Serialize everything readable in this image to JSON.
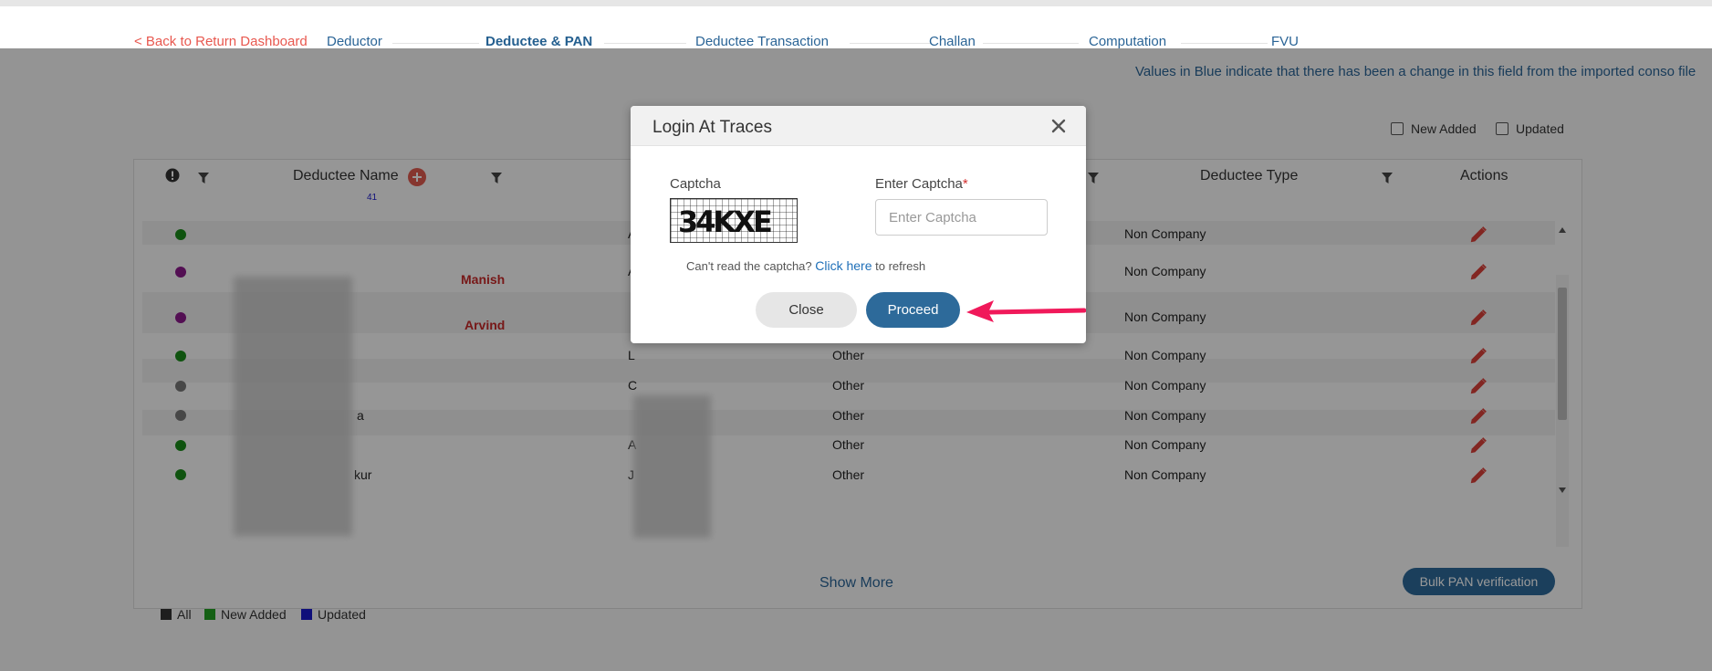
{
  "nav": {
    "back": "< Back to Return Dashboard",
    "steps": [
      "Deductor",
      "Deductee & PAN",
      "Deductee Transaction",
      "Challan",
      "Computation",
      "FVU"
    ],
    "active_step": "Deductee & PAN"
  },
  "notice": "Values in Blue indicate that there has been a change in this field from the imported conso file",
  "filters": {
    "new_added": "New Added",
    "updated": "Updated"
  },
  "table": {
    "headers": {
      "deductee_name": "Deductee Name",
      "deductee_type": "Deductee Type",
      "actions": "Actions"
    },
    "count": "41",
    "rows": [
      {
        "status_color": "#1a8a1a",
        "name_suffix": "",
        "red_name": "",
        "pan": "A",
        "category": "",
        "type": "Non Company"
      },
      {
        "status_color": "#8a1a8a",
        "name_suffix": "",
        "red_name": "Manish",
        "pan": "A",
        "category": "",
        "type": "Non Company"
      },
      {
        "status_color": "#8a1a8a",
        "name_suffix": "",
        "red_name": "Arvind",
        "pan": "",
        "category": "",
        "type": "Non Company"
      },
      {
        "status_color": "#1a8a1a",
        "name_suffix": "",
        "red_name": "",
        "pan": "L",
        "category": "Other",
        "type": "Non Company"
      },
      {
        "status_color": "#777777",
        "name_suffix": "",
        "red_name": "",
        "pan": "C",
        "category": "Other",
        "type": "Non Company"
      },
      {
        "status_color": "#777777",
        "name_suffix": "a",
        "red_name": "",
        "pan": "",
        "category": "Other",
        "type": "Non Company"
      },
      {
        "status_color": "#1a8a1a",
        "name_suffix": "",
        "red_name": "",
        "pan": "A",
        "category": "Other",
        "type": "Non Company"
      },
      {
        "status_color": "#1a8a1a",
        "name_suffix": "kur",
        "red_name": "",
        "pan": "J",
        "category": "Other",
        "type": "Non Company"
      }
    ]
  },
  "show_more": "Show More",
  "bulk_button": "Bulk PAN verification",
  "legend": [
    {
      "label": "All",
      "color": "#333333"
    },
    {
      "label": "New Added",
      "color": "#22a022"
    },
    {
      "label": "Updated",
      "color": "#1a1acc"
    }
  ],
  "modal": {
    "title": "Login At Traces",
    "captcha_label": "Captcha",
    "captcha_text": "34KXE",
    "enter_label": "Enter Captcha",
    "required_mark": "*",
    "placeholder": "Enter Captcha",
    "refresh_prefix": "Can't read the captcha?",
    "refresh_link": "Click here",
    "refresh_suffix": "to refresh",
    "close_btn": "Close",
    "proceed_btn": "Proceed"
  },
  "colors": {
    "accent": "#2d6a9a",
    "edit": "#d9403a",
    "arrow": "#f0195a"
  }
}
